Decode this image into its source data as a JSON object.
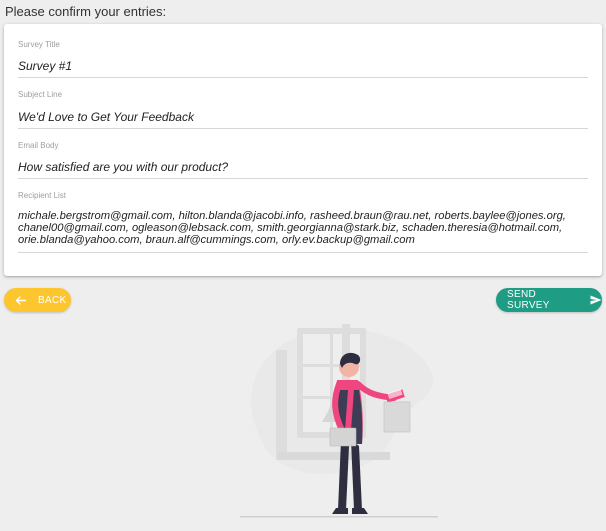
{
  "page": {
    "heading": "Please confirm your entries:"
  },
  "fields": {
    "survey_title": {
      "label": "Survey Title",
      "value": "Survey #1"
    },
    "subject_line": {
      "label": "Subject Line",
      "value": "We'd Love to Get Your Feedback"
    },
    "email_body": {
      "label": "Email Body",
      "value": "How satisfied are you with our product?"
    },
    "recipient_list": {
      "label": "Recipient List",
      "value": "michale.bergstrom@gmail.com, hilton.blanda@jacobi.info, rasheed.braun@rau.net, roberts.baylee@jones.org, chanel00@gmail.com, ogleason@lebsack.com, smith.georgianna@stark.biz, schaden.theresia@hotmail.com, orie.blanda@yahoo.com, braun.alf@cummings.com, orly.ev.backup@gmail.com"
    }
  },
  "actions": {
    "back_label": "Back",
    "send_label": "Send Survey",
    "back_icon": "arrow-left-icon",
    "send_icon": "send-icon"
  },
  "colors": {
    "back": "#fdc62f",
    "send": "#1e9c84",
    "accent": "#f0457e"
  }
}
